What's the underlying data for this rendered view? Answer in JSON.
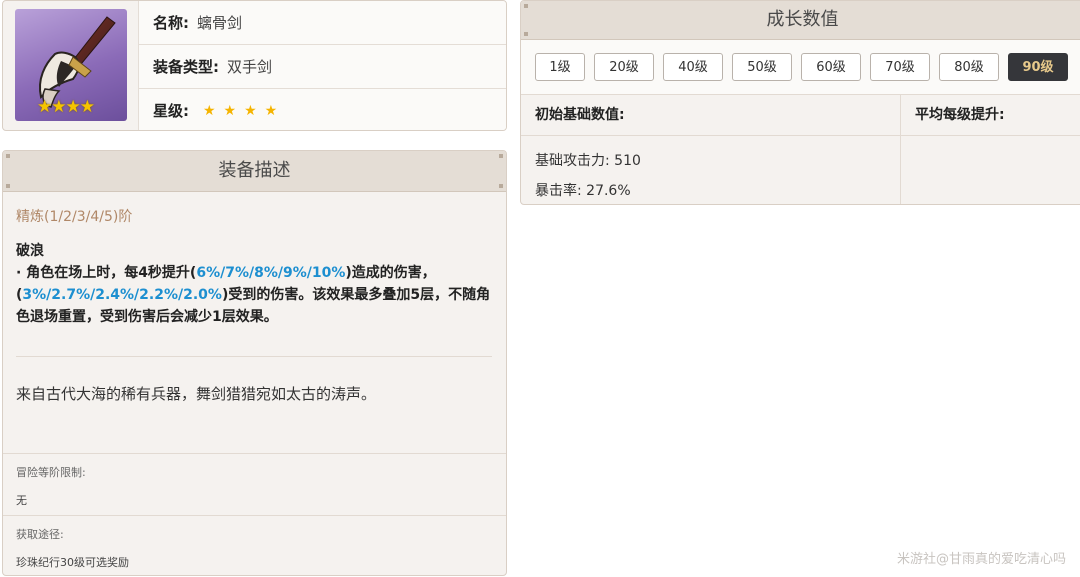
{
  "info": {
    "name_label": "名称:",
    "name_value": "螭骨剑",
    "type_label": "装备类型:",
    "type_value": "双手剑",
    "rarity_label": "星级:",
    "rarity_stars": "★★★★",
    "thumb_stars": "★★★★",
    "rarity_count": 4
  },
  "description": {
    "title": "装备描述",
    "refine_label": "精炼(1/2/3/4/5)阶",
    "skill_name": "破浪",
    "skill_pre": "· 角色在场上时，每4秒提升(",
    "skill_hl1": "6%/7%/8%/9%/10%",
    "skill_mid1": ")造成的伤害，(",
    "skill_hl2": "3%/2.7%/2.4%/2.2%/2.0%",
    "skill_post": ")受到的伤害。该效果最多叠加5层，不随角色退场重置，受到伤害后会减少1层效果。",
    "flavor": "来自古代大海的稀有兵器，舞剑猎猎宛如太古的涛声。",
    "limit_label": "冒险等阶限制:",
    "limit_value": "无",
    "source_label": "获取途径:",
    "source_value": "珍珠纪行30级可选奖励"
  },
  "growth": {
    "title": "成长数值",
    "levels": [
      "1级",
      "20级",
      "40级",
      "50级",
      "60级",
      "70级",
      "80级",
      "90级"
    ],
    "active_level": "90级",
    "col_base": "初始基础数值:",
    "col_avg": "平均每级提升:",
    "stat_atk": "基础攻击力: 510",
    "stat_crit": "暴击率: 27.6%"
  },
  "watermark": "米游社@甘雨真的爱吃清心吗",
  "colors": {
    "highlight": "#1d8fd0",
    "star": "#f5b400",
    "active_level_bg": "#35363a",
    "active_level_text": "#e7c98b"
  }
}
